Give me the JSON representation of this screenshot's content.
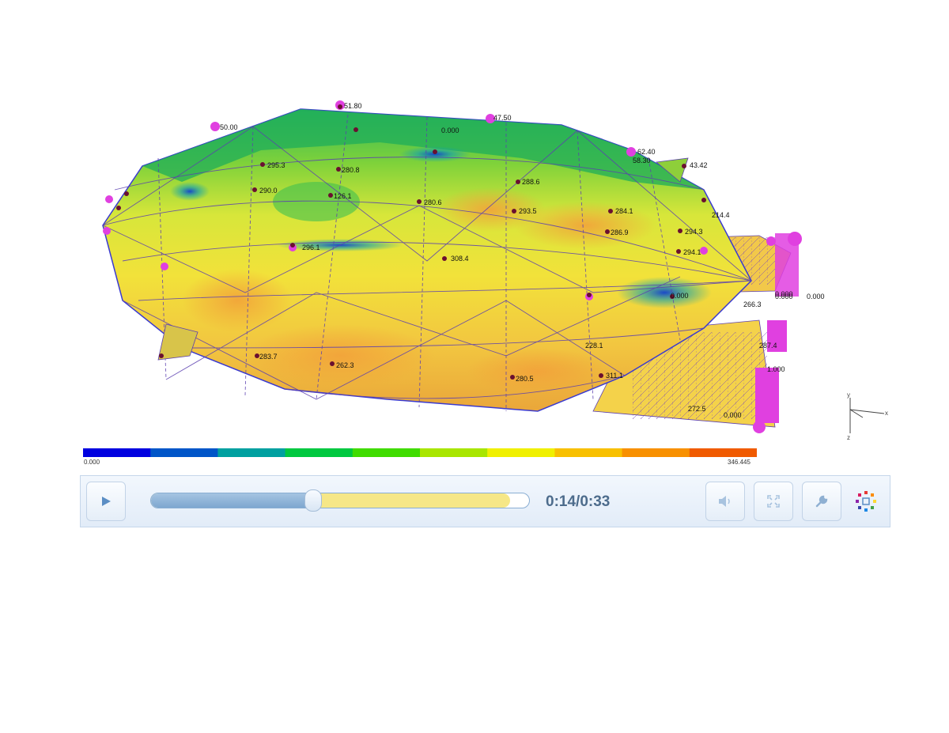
{
  "colorbar": {
    "min_label": "0.000",
    "max_label": "346.445",
    "colors": [
      "#0000e0",
      "#0055c8",
      "#00a0a0",
      "#00c840",
      "#40dc00",
      "#a8e600",
      "#f0f000",
      "#f8c000",
      "#f89000",
      "#f05a00"
    ]
  },
  "model_labels": [
    "51.80",
    "47.50",
    "50.00",
    "62.40",
    "58.30",
    "43.42",
    "0.000",
    "295.3",
    "280.8",
    "290.0",
    "126.1",
    "280.6",
    "288.6",
    "293.5",
    "284.1",
    "286.9",
    "294.3",
    "214.4",
    "294.1",
    "296.1",
    "308.4",
    "0.000",
    "0.000",
    "266.3",
    "287.4",
    "262.3",
    "283.7",
    "280.5",
    "228.1",
    "311.1",
    "272.5",
    "0.000",
    "0.000",
    "0.000",
    "1.000"
  ],
  "player": {
    "current_time": "0:14",
    "total_time": "0:33",
    "separator": "/",
    "played_fraction": 0.43,
    "buffered_fraction": 0.95
  },
  "axes": {
    "x": "x",
    "y": "y",
    "z": "z"
  },
  "icons": {
    "play": "play-icon",
    "volume": "volume-icon",
    "fullscreen": "fullscreen-icon",
    "settings": "wrench-icon",
    "logo": "logo-icon"
  }
}
